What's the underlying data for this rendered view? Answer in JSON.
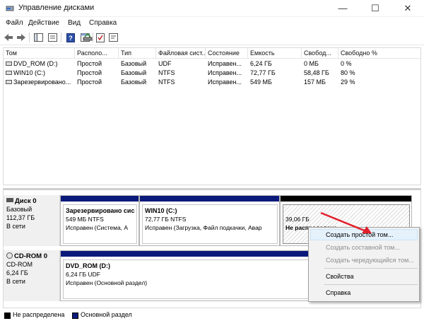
{
  "window": {
    "title": "Управление дисками"
  },
  "menu": [
    "Файл",
    "Действие",
    "Вид",
    "Справка"
  ],
  "columns": [
    "Том",
    "Располо...",
    "Тип",
    "Файловая сист...",
    "Состояние",
    "Емкость",
    "Свобод...",
    "Свободно %"
  ],
  "volumes": [
    [
      "DVD_ROM (D:)",
      "Простой",
      "Базовый",
      "UDF",
      "Исправен...",
      "6,24 ГБ",
      "0 МБ",
      "0 %"
    ],
    [
      "WIN10 (C:)",
      "Простой",
      "Базовый",
      "NTFS",
      "Исправен...",
      "72,77 ГБ",
      "58,48 ГБ",
      "80 %"
    ],
    [
      "Зарезервировано...",
      "Простой",
      "Базовый",
      "NTFS",
      "Исправен...",
      "549 МБ",
      "157 МБ",
      "29 %"
    ]
  ],
  "disks": [
    {
      "name": "Диск 0",
      "type": "Базовый",
      "size": "112,37 ГБ",
      "status": "В сети",
      "partitions": [
        {
          "name": "Зарезервировано сис",
          "info": "549 МБ NTFS",
          "state": "Исправен (Система, А"
        },
        {
          "name": "WIN10 (C:)",
          "info": "72,77 ГБ NTFS",
          "state": "Исправен (Загрузка, Файл подкачки, Авар"
        },
        {
          "name": "",
          "info": "39,06 ГБ",
          "state": "Не распределена"
        }
      ]
    },
    {
      "name": "CD-ROM 0",
      "type": "CD-ROM",
      "size": "6,24 ГБ",
      "status": "В сети",
      "partitions": [
        {
          "name": "DVD_ROM (D:)",
          "info": "6,24 ГБ UDF",
          "state": "Исправен (Основной раздел)"
        }
      ]
    }
  ],
  "legend": [
    "Не распределена",
    "Основной раздел"
  ],
  "context_menu": {
    "items": [
      {
        "label": "Создать простой том...",
        "enabled": true
      },
      {
        "label": "Создать составной том...",
        "enabled": false
      },
      {
        "label": "Создать чередующийся том...",
        "enabled": false
      },
      {
        "label": "Свойства",
        "enabled": true
      },
      {
        "label": "Справка",
        "enabled": true
      }
    ]
  },
  "colors": {
    "primary_partition": "#0a1a7a",
    "unallocated": "#000000",
    "menu_highlight": "#e5f1fb",
    "arrow": "#e0202a"
  },
  "icons": [
    "back-icon",
    "forward-icon",
    "console-tree-icon",
    "help-icon",
    "properties-icon",
    "connect-icon",
    "check-icon",
    "refresh-icon"
  ]
}
